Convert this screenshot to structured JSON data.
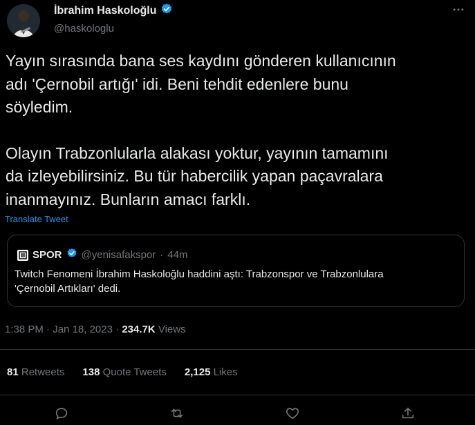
{
  "author": {
    "name": "İbrahim Haskoloğlu",
    "handle": "@haskologlu",
    "verified": true
  },
  "more_icon": "more-icon",
  "tweet": {
    "lines": [
      "Yayın sırasında bana ses kaydını gönderen kullanıcının",
      "adı 'Çernobil artığı' idi. Beni tehdit edenlere bunu",
      "söyledim.",
      "Olayın Trabzonlularla alakası yoktur, yayının tamamını",
      "da izleyebilirsiniz. Bu tür habercilik yapan paçavralara",
      "inanmayınız. Bunların amacı farklı."
    ],
    "translate_label": "Translate Tweet"
  },
  "quote": {
    "name": "SPOR",
    "handle": "@yenisafakspor",
    "separator": "·",
    "time": "44m",
    "lines": [
      "Twitch Fenomeni İbrahim Haskoloğlu haddini aştı: Trabzonspor ve Trabzonlulara",
      "'Çernobil Artıkları' dedi."
    ]
  },
  "meta": {
    "time": "1:38 PM",
    "sep1": "·",
    "date": "Jan 18, 2023",
    "sep2": "·",
    "views_count": "234.7K",
    "views_label": "Views"
  },
  "stats": {
    "retweets_count": "81",
    "retweets_label": "Retweets",
    "quotes_count": "138",
    "quotes_label": "Quote Tweets",
    "likes_count": "2,125",
    "likes_label": "Likes"
  },
  "colors": {
    "background": "#000000",
    "text": "#e7e9ea",
    "muted": "#71767b",
    "accent": "#1d9bf0",
    "border": "#2f3336"
  }
}
